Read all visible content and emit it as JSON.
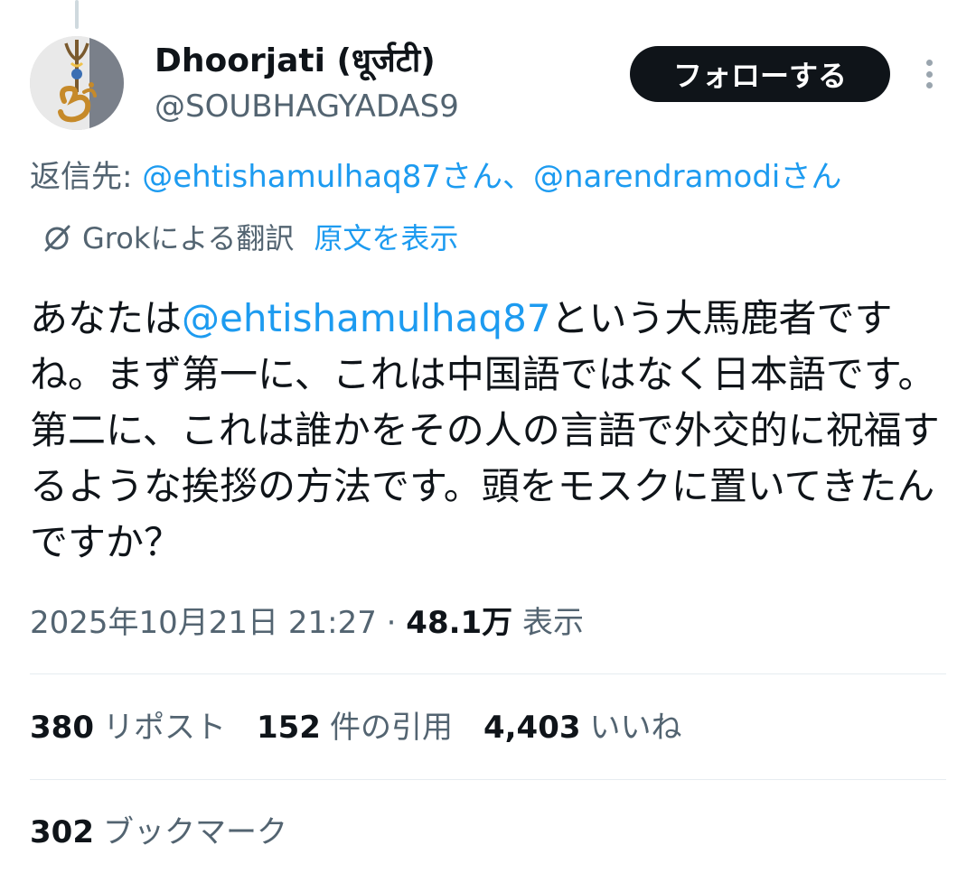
{
  "author": {
    "display_name": "Dhoorjati (धूर्जटी)",
    "handle": "@SOUBHAGYADAS9"
  },
  "follow_button": "フォローする",
  "reply_to": {
    "prefix": "返信先: ",
    "mention1": "@ehtishamulhaq87さん",
    "separator": "、",
    "mention2": "@narendramodiさん"
  },
  "translation": {
    "label": "Grokによる翻訳",
    "show_original": "原文を表示"
  },
  "tweet": {
    "text_before": "あなたは",
    "mention": "@ehtishamulhaq87",
    "text_after": "という大馬鹿者ですね。まず第一に、これは中国語ではなく日本語です。第二に、これは誰かをその人の言語で外交的に祝福するような挨拶の方法です。頭をモスクに置いてきたんですか？"
  },
  "meta": {
    "timestamp": "2025年10月21日 21:27",
    "separator": " · ",
    "views_count": "48.1万",
    "views_label": " 表示"
  },
  "stats": {
    "reposts": {
      "count": "380",
      "label": "リポスト"
    },
    "quotes": {
      "count": "152",
      "label": "件の引用"
    },
    "likes": {
      "count": "4,403",
      "label": "いいね"
    },
    "bookmarks": {
      "count": "302",
      "label": "ブックマーク"
    }
  },
  "colors": {
    "text_primary": "#0f1419",
    "text_secondary": "#536471",
    "link": "#1d9bf0",
    "follow_bg": "#0f1419"
  },
  "icons": {
    "avatar": "om-trishul-avatar",
    "grok": "grok-icon",
    "more": "more-vertical-icon"
  }
}
